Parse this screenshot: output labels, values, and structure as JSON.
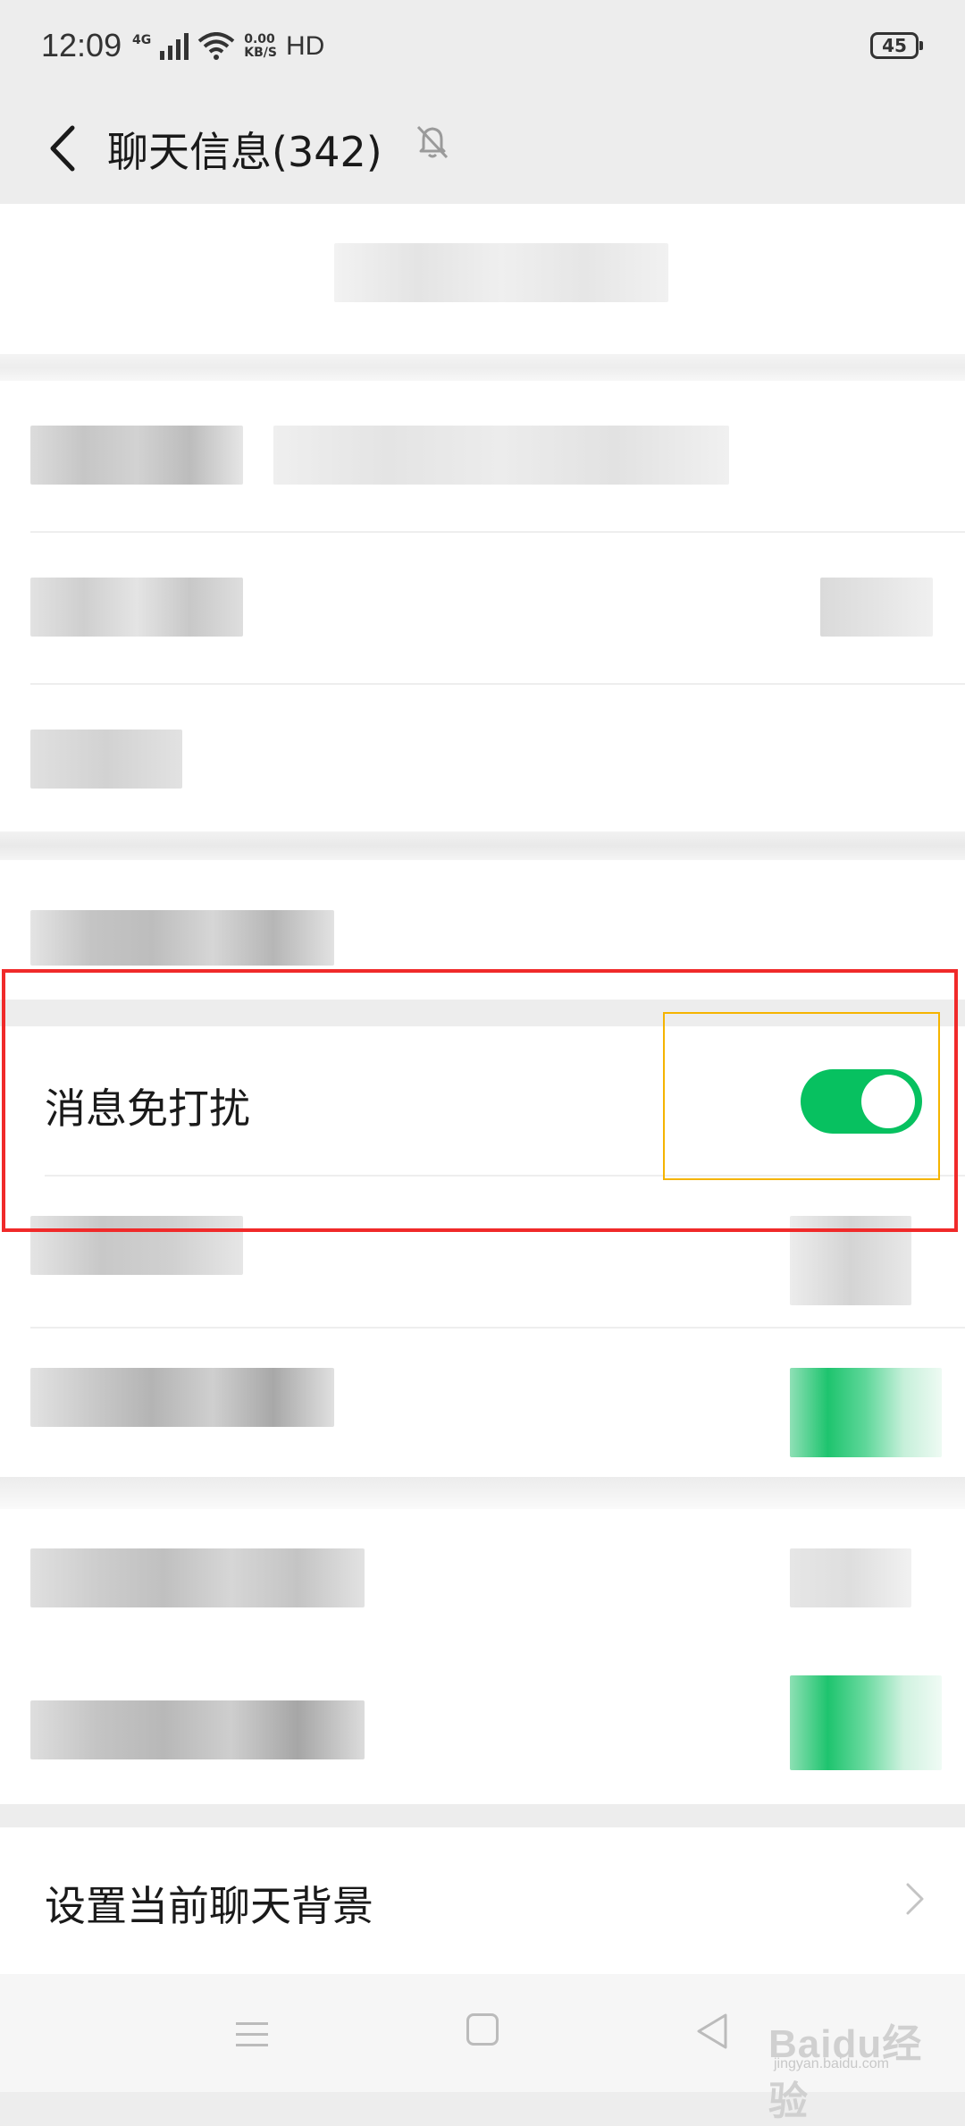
{
  "status_bar": {
    "time": "12:09",
    "network": "4G",
    "speed_value": "0.00",
    "speed_unit": "KB/S",
    "hd": "HD",
    "battery": "45"
  },
  "nav": {
    "title": "聊天信息(342)",
    "back_icon": "chevron-left-icon",
    "muted_icon": "bell-off-icon"
  },
  "settings": {
    "mute_notifications": {
      "label": "消息免打扰",
      "enabled": true
    },
    "set_chat_background": {
      "label": "设置当前聊天背景"
    }
  },
  "colors": {
    "accent_green": "#07c160",
    "highlight_red": "#f02a2a",
    "highlight_yellow": "#f5b400",
    "page_bg": "#ededed"
  },
  "bottom_nav": {
    "icons": [
      "menu-icon",
      "home-icon",
      "back-triangle-icon"
    ]
  },
  "watermark": {
    "brand": "Baidu经验",
    "site": "jingyan.baidu.com"
  }
}
